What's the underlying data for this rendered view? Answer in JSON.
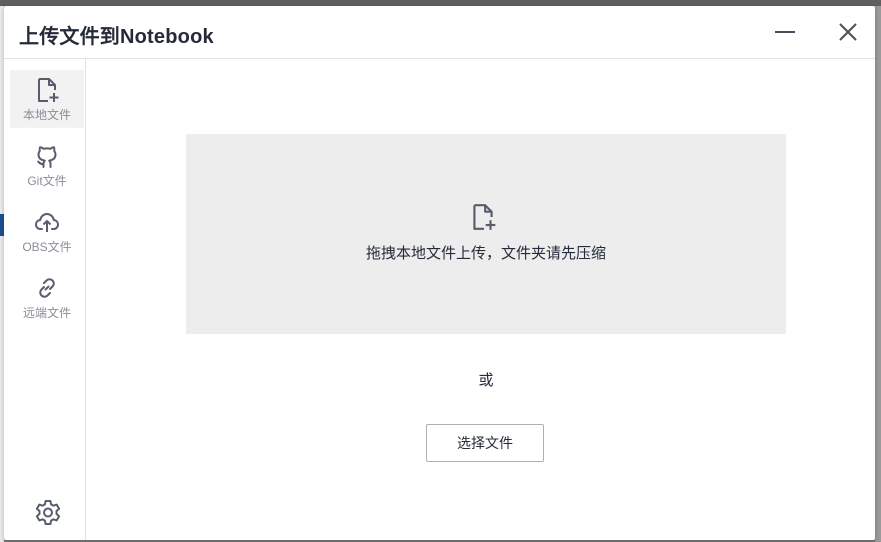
{
  "dialog": {
    "title": "上传文件到Notebook"
  },
  "header": {
    "minimize_icon": "minimize-icon",
    "close_icon": "close-icon"
  },
  "sidebar": {
    "items": [
      {
        "label": "本地文件",
        "icon": "file-add-icon",
        "active": true
      },
      {
        "label": "Git文件",
        "icon": "github-icon",
        "active": false
      },
      {
        "label": "OBS文件",
        "icon": "cloud-upload-icon",
        "active": false
      },
      {
        "label": "远端文件",
        "icon": "link-icon",
        "active": false
      }
    ],
    "settings_icon": "gear-icon"
  },
  "main": {
    "dropzone_text": "拖拽本地文件上传，文件夹请先压缩",
    "dropzone_icon": "file-add-icon",
    "or_text": "或",
    "select_button_label": "选择文件"
  },
  "colors": {
    "text": "#252b3a",
    "muted": "#8a8e99",
    "dropzone_bg": "#ededed",
    "border": "#dfe1e6"
  }
}
